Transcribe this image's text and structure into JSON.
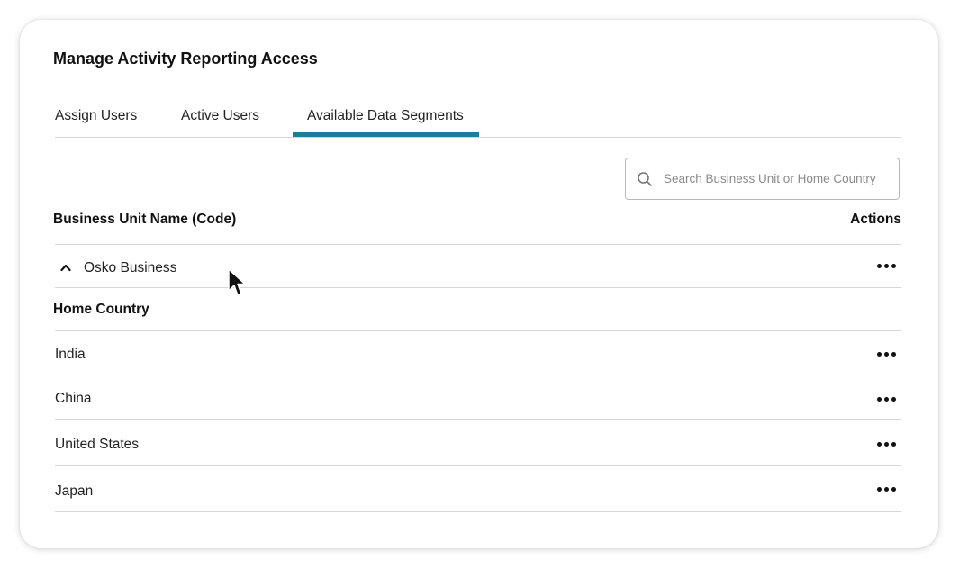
{
  "dialog": {
    "title": "Manage Activity Reporting Access"
  },
  "tabs": [
    {
      "label": "Assign Users",
      "active": false
    },
    {
      "label": "Active Users",
      "active": false
    },
    {
      "label": "Available Data Segments",
      "active": true
    }
  ],
  "search": {
    "placeholder": "Search Business Unit or Home Country",
    "value": "",
    "icon": "search-icon"
  },
  "table": {
    "header_name": "Business Unit Name (Code)",
    "header_actions": "Actions",
    "group": {
      "name": "Osko Business",
      "expanded": true,
      "icon": "chevron-up-icon"
    },
    "subheader": "Home Country",
    "rows": [
      {
        "label": "India"
      },
      {
        "label": "China"
      },
      {
        "label": "United States"
      },
      {
        "label": "Japan"
      }
    ]
  },
  "colors": {
    "accent": "#1f7c97",
    "divider": "#d6d6d6",
    "text": "#222222"
  }
}
